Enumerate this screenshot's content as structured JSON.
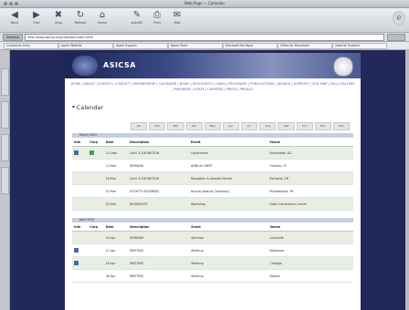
{
  "window": {
    "title": "Web Page — Calendar"
  },
  "toolbar": [
    {
      "label": "Back",
      "icon": "arrow-left-icon",
      "glyph": "◀"
    },
    {
      "label": "Fwd",
      "icon": "arrow-right-icon",
      "glyph": "▶"
    },
    {
      "label": "Stop",
      "icon": "stop-icon",
      "glyph": "✖"
    },
    {
      "label": "Refresh",
      "icon": "refresh-icon",
      "glyph": "↻"
    },
    {
      "label": "Home",
      "icon": "home-icon",
      "glyph": "⌂"
    },
    {
      "label": "AutoFill",
      "icon": "autofill-icon",
      "glyph": "✎"
    },
    {
      "label": "Print",
      "icon": "print-icon",
      "glyph": "⎙"
    },
    {
      "label": "Mail",
      "icon": "mail-icon",
      "glyph": "✉"
    }
  ],
  "address": {
    "label": "Address",
    "value": "http://www.asicsa.org/calendar/index.html"
  },
  "favorites": [
    "Customize Links",
    "Apple Website",
    "Apple Support",
    "Apple Store",
    "Microsoft MacTopia",
    "Office for Macintosh",
    "Internet Explorer"
  ],
  "sidetabs": [
    "Favorites",
    "History",
    "Search",
    "Scrapbook"
  ],
  "site": {
    "logo": "ASICSA",
    "nav": "HOME | ABOUT | EVENTS | CONTACT | MEMBERSHIP | CALENDAR | NEWS | RESOURCES | LINKS | PROGRAMS | PUBLICATIONS | SEARCH | SUPPORT | SITE MAP | FAQ | GALLERY | PARTNERS | STAFF | CAREERS | PRESS | PRIVACY"
  },
  "page_title": "Calendar",
  "months": [
    "Jan",
    "Feb",
    "Mar",
    "Apr",
    "May",
    "Jun",
    "Jul",
    "Aug",
    "Sep",
    "Oct",
    "Nov",
    "Dec"
  ],
  "columns": [
    "Info",
    "Corp",
    "Date",
    "Description",
    "Event",
    "Venue"
  ],
  "sections": [
    {
      "name": "March 2003",
      "rows": [
        {
          "info": "blue",
          "corp": "green",
          "date": "3-5 Mar",
          "desc": "Conf. & EXHIBITION",
          "event": "Conference",
          "venue": "Scottsdale, AZ"
        },
        {
          "info": "",
          "corp": "",
          "date": "14 Mar",
          "desc": "SEMINAR",
          "event": "ANNUAL MEET",
          "venue": "Orlando, FL"
        },
        {
          "info": "",
          "corp": "",
          "date": "18 Mar",
          "desc": "Conf. & EXHIBITION",
          "event": "Reception & Awards Dinner",
          "venue": "Portland, OR"
        },
        {
          "info": "",
          "corp": "",
          "date": "22 Mar",
          "desc": "SOCIETY ASSEMBLY",
          "event": "Annual Awards Ceremony",
          "venue": "Philadelphia, PA"
        },
        {
          "info": "",
          "corp": "",
          "date": "25 Mar",
          "desc": "WORKSHOP",
          "event": "Workshop",
          "venue": "Hotel Conference Center"
        }
      ]
    },
    {
      "name": "April 2003",
      "rows": [
        {
          "info": "",
          "corp": "",
          "date": "10 Apr",
          "desc": "SEMINAR",
          "event": "Seminar",
          "venue": "Louisville"
        },
        {
          "info": "blue",
          "corp": "",
          "date": "12 Apr",
          "desc": "MEETING",
          "event": "Meeting",
          "venue": "Baltimore"
        },
        {
          "info": "blue",
          "corp": "",
          "date": "18 Apr",
          "desc": "MEETING",
          "event": "Meeting",
          "venue": "Chicago"
        },
        {
          "info": "",
          "corp": "",
          "date": "26 Apr",
          "desc": "MEETING",
          "event": "Meeting",
          "venue": "Boston"
        }
      ]
    }
  ]
}
